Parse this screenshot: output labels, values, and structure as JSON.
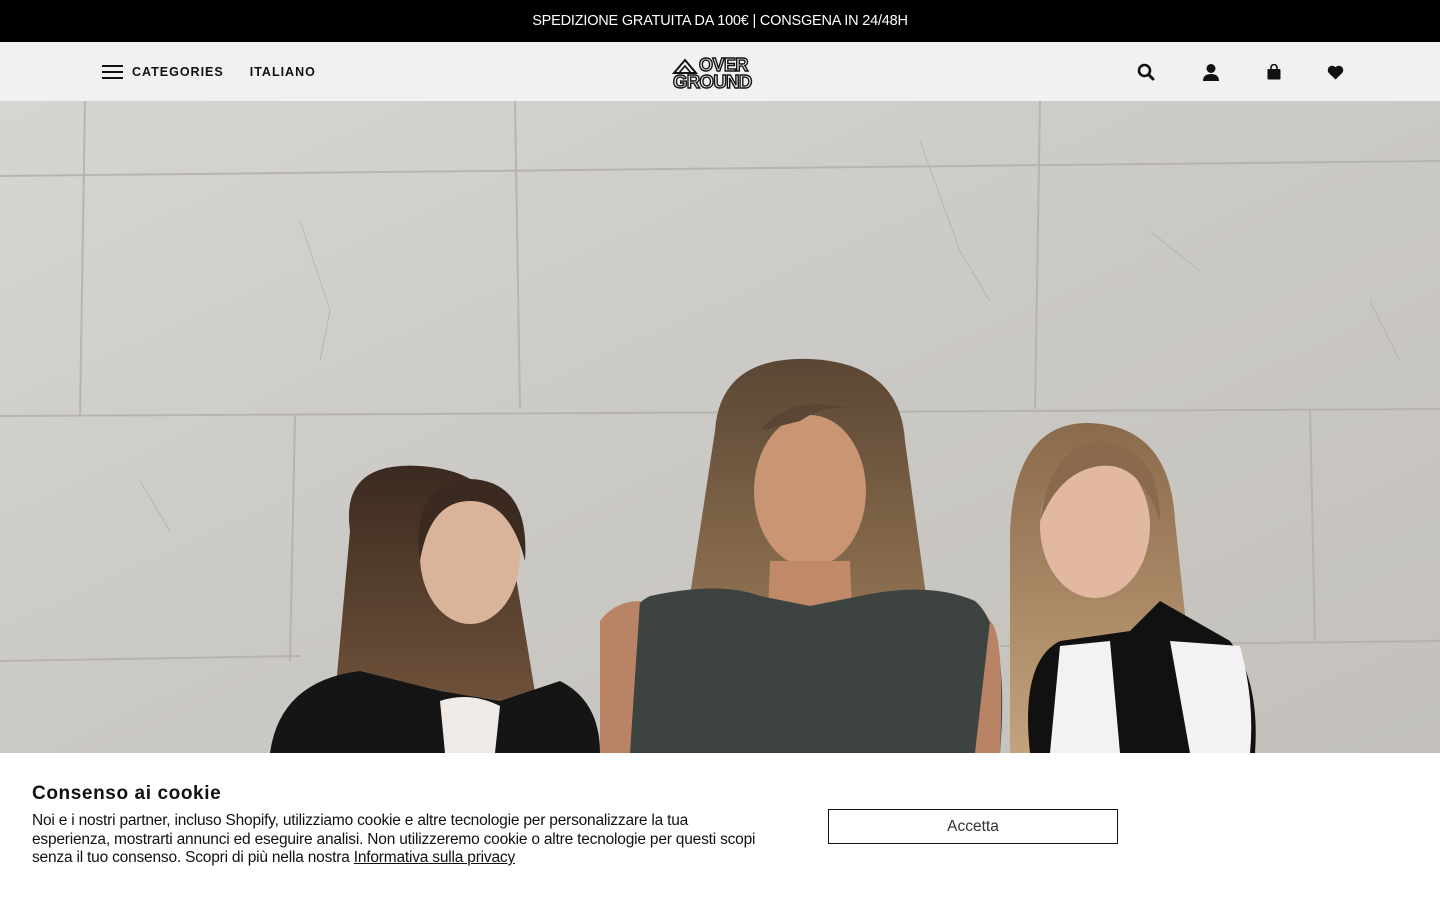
{
  "announcement": {
    "text": "SPEDIZIONE GRATUITA DA 100€ | CONSGENA IN 24/48H"
  },
  "header": {
    "categories_label": "CATEGORIES",
    "language_label": "ITALIANO",
    "logo": {
      "line1": "OVER",
      "line2": "GROUND",
      "icon": "mountain-logo-icon"
    },
    "icons": [
      "search-icon",
      "account-icon",
      "cart-icon",
      "wishlist-heart-icon"
    ]
  },
  "hero": {
    "image": "three-models-against-stone-wall"
  },
  "cookie_banner": {
    "title": "Consenso ai cookie",
    "text": "Noi e i nostri partner, incluso Shopify, utilizziamo cookie e altre tecnologie per personalizzare la tua esperienza, mostrarti annunci ed eseguire analisi. Non utilizzeremo cookie o altre tecnologie per questi scopi senza il tuo consenso. Scopri di più nella nostra",
    "link_text": "Informativa sulla privacy",
    "accept_label": "Accetta"
  },
  "colors": {
    "bar": "#000000",
    "header_bg": "#f1f1f1",
    "text": "#111111",
    "banner_bg": "#ffffff"
  }
}
